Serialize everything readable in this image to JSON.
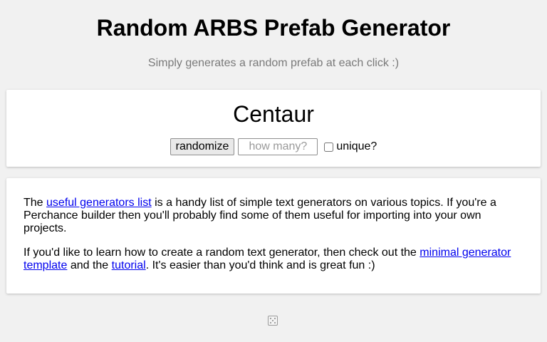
{
  "header": {
    "title": "Random ARBS Prefab Generator",
    "subtitle": "Simply generates a random prefab at each click :)"
  },
  "generator": {
    "result": "Centaur",
    "randomize_label": "randomize",
    "count_placeholder": "how many?",
    "unique_label": "unique?",
    "unique_checked": false
  },
  "info": {
    "p1_prefix": "The ",
    "p1_link": "useful generators list",
    "p1_suffix": " is a handy list of simple text generators on various topics. If you're a Perchance builder then you'll probably find some of them useful for importing into your own projects.",
    "p2_prefix": "If you'd like to learn how to create a random text generator, then check out the ",
    "p2_link1": "minimal generator template",
    "p2_middle": " and the ",
    "p2_link2": "tutorial",
    "p2_suffix": ". It's easier than you'd think and is great fun :)"
  },
  "footer": {
    "icon": "dice-icon"
  },
  "colors": {
    "background": "#f1f1f1",
    "card": "#ffffff",
    "link": "#0000ee",
    "subtitle": "#7a7a7a"
  }
}
